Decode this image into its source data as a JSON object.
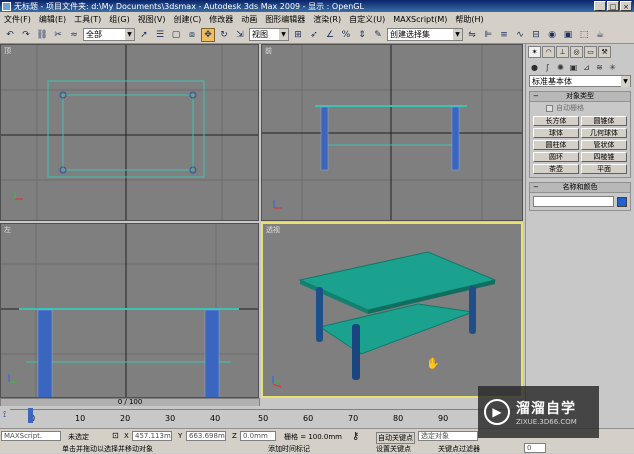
{
  "window": {
    "title": "无标题     - 项目文件夹: d:\\My Documents\\3dsmax       - Autodesk 3ds Max  2009       - 显示 : OpenGL",
    "controls": [
      "_",
      "□",
      "×"
    ]
  },
  "menu": [
    "文件(F)",
    "编辑(E)",
    "工具(T)",
    "组(G)",
    "视图(V)",
    "创建(C)",
    "修改器",
    "动画",
    "图形编辑器",
    "渲染(R)",
    "自定义(U)",
    "MAXScript(M)",
    "帮助(H)"
  ],
  "toolbar": {
    "selection_filter": "全部",
    "reference_coord": "视图",
    "named_selection": "创建选择集",
    "icons": [
      "undo-icon",
      "redo-icon",
      "link-icon",
      "unlink-icon",
      "bind-icon",
      "select-icon",
      "select-by-name-icon",
      "rect-region-icon",
      "window-crossing-icon",
      "move-icon",
      "rotate-icon",
      "scale-icon",
      "pivot-icon",
      "snap-icon",
      "angle-snap-icon",
      "percent-snap-icon",
      "spinner-snap-icon",
      "edit-named-icon",
      "mirror-icon",
      "align-icon",
      "layer-icon",
      "curve-editor-icon",
      "schematic-icon",
      "material-editor-icon",
      "render-setup-icon",
      "render-frame-icon",
      "render-icon"
    ]
  },
  "viewports": {
    "top": {
      "label": "顶"
    },
    "front": {
      "label": "前"
    },
    "left": {
      "label": "左"
    },
    "perspective": {
      "label": "透视"
    }
  },
  "command_panel": {
    "category": "标准基本体",
    "object_type_title": "对象类型",
    "autogrid": "自动栅格",
    "buttons": [
      "长方体",
      "圆锥体",
      "球体",
      "几何球体",
      "圆柱体",
      "管状体",
      "圆环",
      "四棱锥",
      "茶壶",
      "平面"
    ],
    "name_color_title": "名称和颜色",
    "swatch_color": "#2060d0"
  },
  "timeline": {
    "slider_text": "0 / 100",
    "ticks": [
      "0",
      "10",
      "20",
      "30",
      "40",
      "50",
      "60",
      "70",
      "80",
      "90"
    ]
  },
  "status": {
    "maxscript": "MAXScript.",
    "none_selected": "未选定",
    "x_label": "X",
    "x_value": "457.113m",
    "y_label": "Y",
    "y_value": "663.698m",
    "z_label": "Z",
    "z_value": "0.0mm",
    "grid": "栅格 = 100.0mm",
    "auto_key": "自动关键点",
    "selected_obj": "选定对象",
    "set_key": "设置关键点",
    "key_filter": "关键点过滤器",
    "prompt": "单击并拖动以选择并移动对象",
    "add_time_tag": "添加时间标记",
    "frame": "0"
  },
  "watermark": {
    "brand": "溜溜自学",
    "url": "ZIXUE.3D66.COM"
  }
}
